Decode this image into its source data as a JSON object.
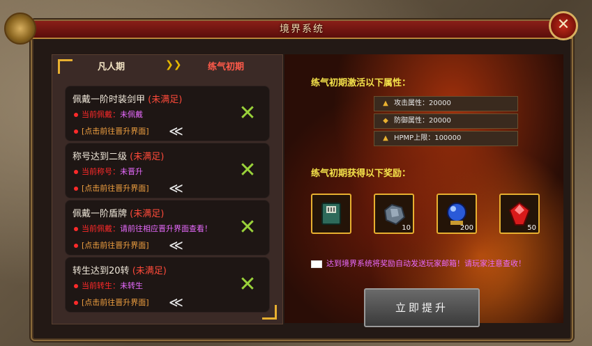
{
  "window": {
    "title": "境界系统",
    "close_icon": "close-icon"
  },
  "tabs": {
    "current": "凡人期",
    "arrow": "❯❯",
    "next": "练气初期"
  },
  "requirements": [
    {
      "title": "佩戴一阶时装剑甲",
      "status": "(未满足)",
      "info_label": "当前佩戴：",
      "info_value": "未佩戴",
      "link": "[点击前往晋升界面]"
    },
    {
      "title": "称号达到二级",
      "status": "(未满足)",
      "info_label": "当前称号：",
      "info_value": "未晋升",
      "link": "[点击前往晋升界面]"
    },
    {
      "title": "佩戴一阶盾牌",
      "status": "(未满足)",
      "info_label": "当前佩戴：",
      "info_value": "请前往相应晋升界面查看！",
      "link": "[点击前往晋升界面]"
    },
    {
      "title": "转生达到20转",
      "status": "(未满足)",
      "info_label": "当前转生：",
      "info_value": "未转生",
      "link": "[点击前往晋升界面]"
    }
  ],
  "activation": {
    "heading": "练气初期激活以下属性：",
    "attributes": [
      {
        "label": "攻击属性：20000",
        "icon": "attack-icon"
      },
      {
        "label": "防御属性：20000",
        "icon": "defense-icon"
      },
      {
        "label": "HPMP上限：100000",
        "icon": "hpmp-icon"
      }
    ]
  },
  "rewards": {
    "heading": "练气初期获得以下奖励：",
    "items": [
      {
        "icon": "book-icon",
        "count": ""
      },
      {
        "icon": "ore-icon",
        "count": "10"
      },
      {
        "icon": "orb-icon",
        "count": "200"
      },
      {
        "icon": "red-gem-icon",
        "count": "50"
      }
    ]
  },
  "mail_notice": "达到境界系统将奖励自动发送玩家邮箱！请玩家注意查收！",
  "upgrade_button": "立即提升"
}
